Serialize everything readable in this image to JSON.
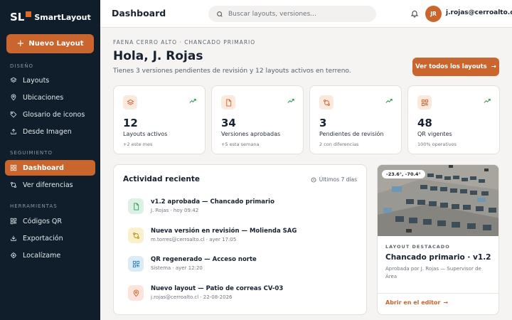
{
  "brand": {
    "mark": "SL",
    "name": "SmartLayout",
    "accent": "#c9652d",
    "sidebar_bg": "#0f1e2a"
  },
  "sidebar": {
    "new_button": "Nuevo Layout",
    "sections": [
      {
        "title": "DISEÑO",
        "items": [
          {
            "label": "Layouts",
            "icon": "layers-icon"
          },
          {
            "label": "Ubicaciones",
            "icon": "map-pin-icon"
          },
          {
            "label": "Glosario de iconos",
            "icon": "tag-icon"
          },
          {
            "label": "Desde Imagen",
            "icon": "upload-icon"
          }
        ]
      },
      {
        "title": "SEGUIMIENTO",
        "items": [
          {
            "label": "Dashboard",
            "icon": "grid-icon",
            "active": true
          },
          {
            "label": "Ver diferencias",
            "icon": "git-compare-icon"
          }
        ]
      },
      {
        "title": "HERRAMIENTAS",
        "items": [
          {
            "label": "Códigos QR",
            "icon": "qr-icon"
          },
          {
            "label": "Exportación",
            "icon": "download-icon"
          },
          {
            "label": "Localízame",
            "icon": "crosshair-icon"
          }
        ]
      }
    ]
  },
  "header": {
    "title": "Dashboard",
    "search_placeholder": "Buscar layouts, versiones...",
    "user_initials": "JR",
    "user_email": "j.rojas@cerroalto.cl"
  },
  "main": {
    "eyebrow": "FAENA CERRO ALTO · CHANCADO PRIMARIO",
    "greeting": "Hola, J. Rojas",
    "subtitle": "Tienes 3 versiones pendientes de revisión y 12 layouts activos en terreno.",
    "all_button": "Ver todos los layouts"
  },
  "stats": [
    {
      "value": "12",
      "label": "Layouts activos",
      "sub": "+2 este mes",
      "icon": "layers-icon"
    },
    {
      "value": "34",
      "label": "Versiones aprobadas",
      "sub": "+5 esta semana",
      "icon": "file-icon"
    },
    {
      "value": "3",
      "label": "Pendientes de revisión",
      "sub": "2 con diferencias",
      "icon": "git-compare-icon"
    },
    {
      "value": "48",
      "label": "QR vigentes",
      "sub": "100% operativos",
      "icon": "qr-icon"
    }
  ],
  "activity": {
    "title": "Actividad reciente",
    "range": "Últimos 7 días",
    "items": [
      {
        "title": "v1.2 aprobada — Chancado primario",
        "meta": "J. Rojas · hoy 09:42",
        "icon": "file-icon",
        "bg": "#dcf1e3",
        "fg": "#2f9a58"
      },
      {
        "title": "Nueva versión en revisión — Molienda SAG",
        "meta": "m.torres@cerroalto.cl · ayer 17:05",
        "icon": "git-compare-icon",
        "bg": "#fbf0cc",
        "fg": "#b58a12"
      },
      {
        "title": "QR regenerado — Acceso norte",
        "meta": "Sistema · ayer 12:20",
        "icon": "qr-icon",
        "bg": "#dcecf7",
        "fg": "#2e7fb6"
      },
      {
        "title": "Nuevo layout — Patio de correas CV-03",
        "meta": "j.rojas@cerroalto.cl · 22-08-2026",
        "icon": "map-pin-icon",
        "bg": "#fbe4dc",
        "fg": "#c9652d"
      }
    ]
  },
  "featured": {
    "coords": "-23.6°, -70.4°",
    "eyebrow": "LAYOUT DESTACADO",
    "title": "Chancado primario · v1.2",
    "desc": "Aprobada por J. Rojas — Supervisor de Área",
    "link": "Abrir en el editor"
  }
}
